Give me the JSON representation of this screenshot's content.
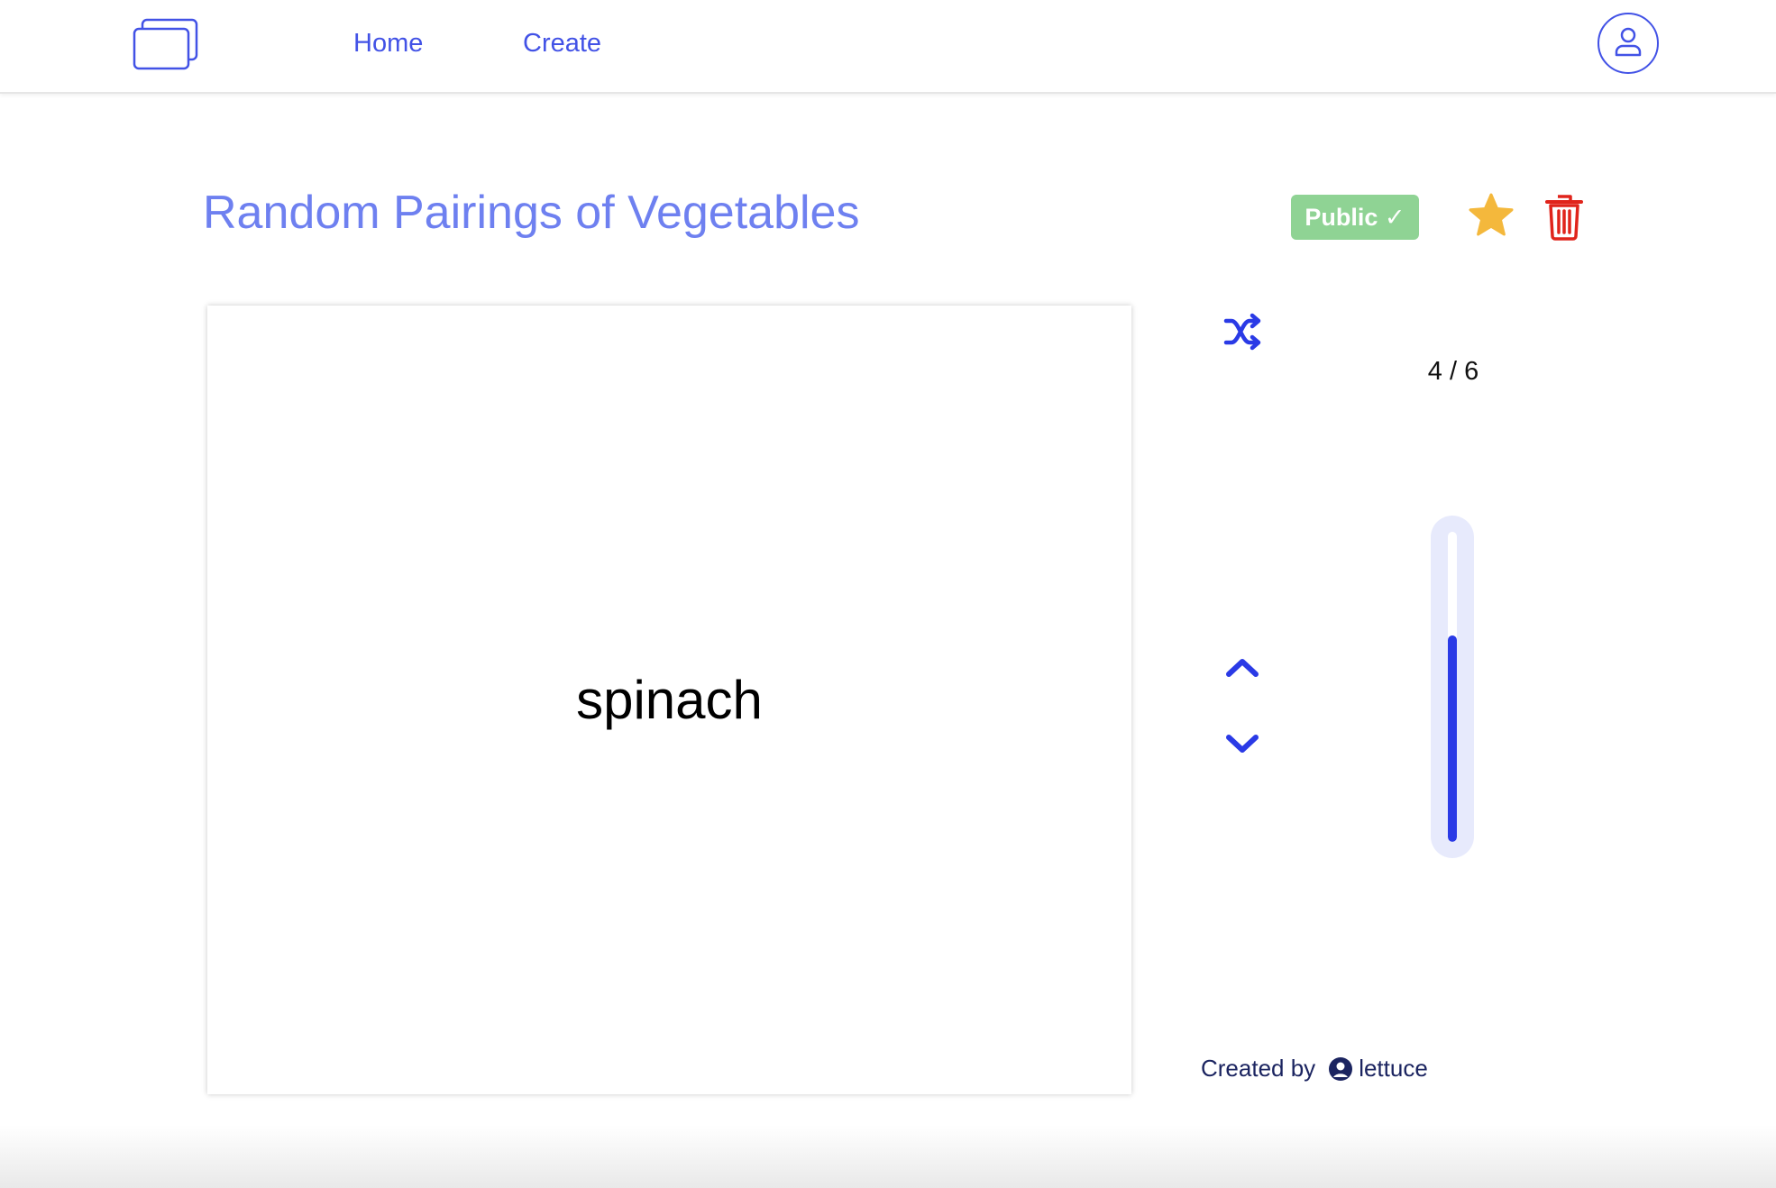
{
  "nav": {
    "logo_icon": "stacked-cards-icon",
    "home_label": "Home",
    "create_label": "Create",
    "profile_icon": "user-icon"
  },
  "set": {
    "title": "Random Pairings of Vegetables",
    "visibility_label": "Public ✓",
    "favorite_icon": "star-icon",
    "delete_icon": "trash-icon"
  },
  "card": {
    "text": "spinach"
  },
  "controls": {
    "shuffle_icon": "shuffle-icon",
    "previous_icon": "chevron-up-icon",
    "next_icon": "chevron-down-icon",
    "counter": "4 / 6",
    "progress": 0.6667
  },
  "footer": {
    "created_by_label": "Created by",
    "author_icon": "user-circle-icon",
    "author": "lettuce"
  },
  "colors": {
    "accent": "#4252e6",
    "title": "#6e80f0",
    "badge": "#8fd394",
    "star": "#f4b83c",
    "delete": "#e0241b",
    "progress": "#2a3ae6"
  }
}
